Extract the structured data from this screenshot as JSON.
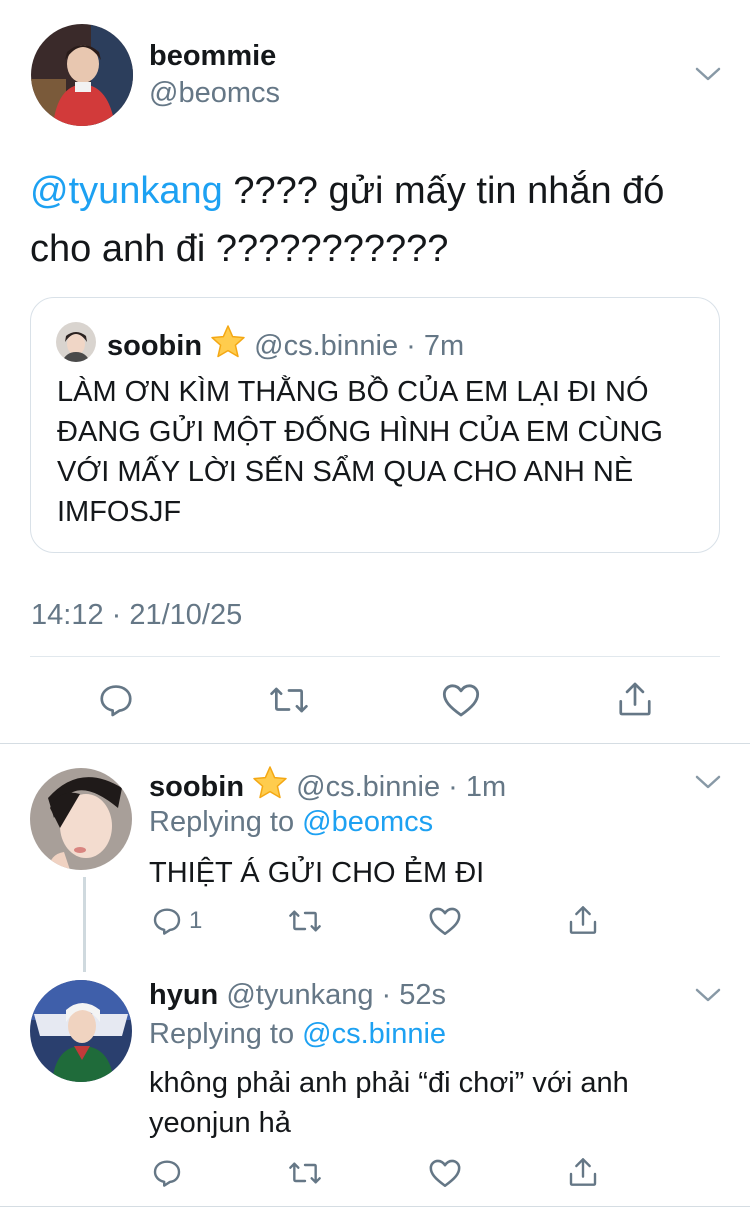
{
  "main_tweet": {
    "display_name": "beommie",
    "handle": "@beomcs",
    "mention": "@tyunkang",
    "text_line1": " ???? gửi mấy tin nhắn đó",
    "text_line2": "cho anh đi ???????????",
    "timestamp": "14:12 · 21/10/25",
    "quoted": {
      "display_name": "soobin",
      "handle": "@cs.binnie",
      "time": "· 7m",
      "lines": [
        "LÀM ƠN KÌM THẰNG BỒ CỦA EM LẠI ĐI NÓ",
        "ĐANG GỬI MỘT ĐỐNG HÌNH CỦA EM CÙNG",
        "VỚI MẤY LỜI SẾN SẨM QUA CHO ANH NÈ",
        "IMFOSJF"
      ]
    }
  },
  "replies": [
    {
      "display_name": "soobin",
      "handle": "@cs.binnie",
      "time": "· 1m",
      "replying_prefix": "Replying to ",
      "replying_to": "@beomcs",
      "text_lines": [
        "THIỆT Á GỬI CHO ẺM ĐI"
      ],
      "reply_count": "1"
    },
    {
      "display_name": "hyun",
      "handle": "@tyunkang",
      "time": "· 52s",
      "replying_prefix": "Replying to ",
      "replying_to": "@cs.binnie",
      "text_lines": [
        "không phải anh phải “đi chơi” với anh",
        "yeonjun hả"
      ],
      "reply_count": ""
    }
  ],
  "colors": {
    "accent": "#1da1f2",
    "secondary_text": "#657786",
    "divider": "#e1e8ed",
    "star": "#ffcc4d"
  },
  "icons": [
    "reply-icon",
    "retweet-icon",
    "like-icon",
    "share-icon",
    "chevron-down-icon",
    "star-emoji-icon"
  ]
}
